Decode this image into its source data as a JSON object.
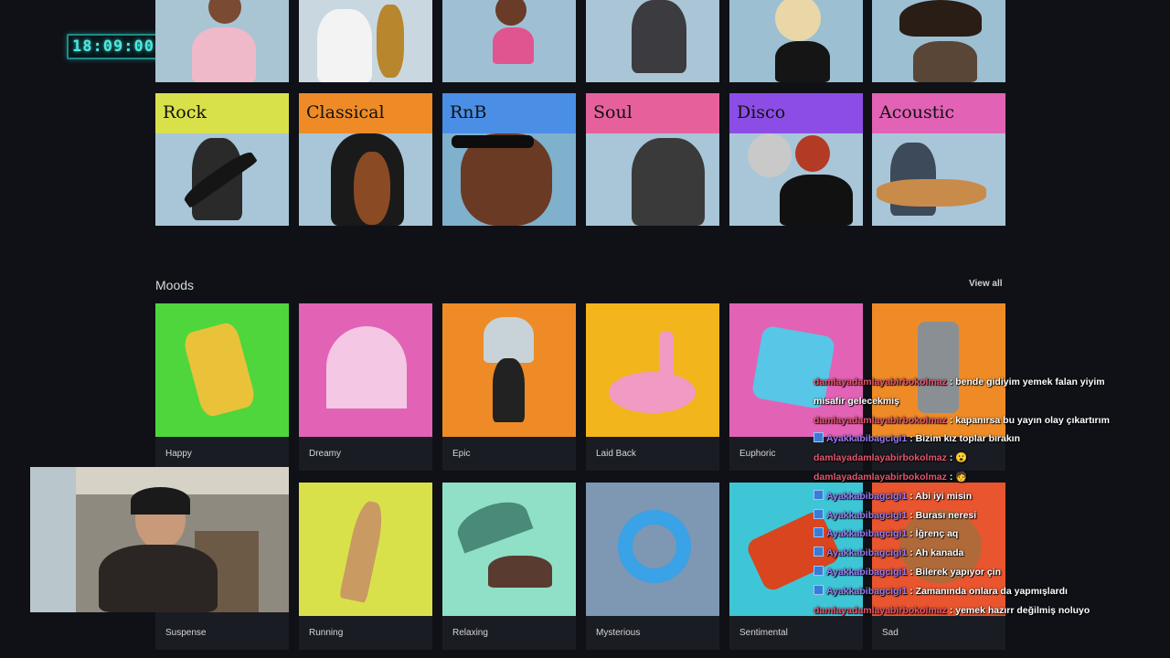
{
  "clock": "18:09:00",
  "genres": [
    {
      "label": "Rock",
      "color": "#d9e14a"
    },
    {
      "label": "Classical",
      "color": "#ee8b26"
    },
    {
      "label": "RnB",
      "color": "#4a8ee6"
    },
    {
      "label": "Soul",
      "color": "#e6619c"
    },
    {
      "label": "Disco",
      "color": "#8c4de6"
    },
    {
      "label": "Acoustic",
      "color": "#e262b6"
    }
  ],
  "moods_section": {
    "title": "Moods",
    "view_all": "View all"
  },
  "moods_row1": [
    {
      "label": "Happy",
      "color": "#4fd63c"
    },
    {
      "label": "Dreamy",
      "color": "#e263b6"
    },
    {
      "label": "Epic",
      "color": "#ee8b26"
    },
    {
      "label": "Laid Back",
      "color": "#f2b51c"
    },
    {
      "label": "Euphoric",
      "color": "#e263b6"
    },
    {
      "label": "",
      "color": "#ee8b26"
    }
  ],
  "moods_row2": [
    {
      "label": "Suspense",
      "color": "#1a1c24"
    },
    {
      "label": "Running",
      "color": "#d9e14a"
    },
    {
      "label": "Relaxing",
      "color": "#8fe0c6"
    },
    {
      "label": "Mysterious",
      "color": "#7e97b3"
    },
    {
      "label": "Sentimental",
      "color": "#3ec6d6"
    },
    {
      "label": "Sad",
      "color": "#e8552e"
    }
  ],
  "chat": [
    {
      "user": "damlayadamlayabirbokolmaz",
      "type": "a",
      "text": ": bende gidiyim yemek falan yiyim misafir gelecekmiş"
    },
    {
      "user": "damlayadamlayabirbokolmaz",
      "type": "a",
      "text": ": kapanırsa bu yayın olay çıkartırım"
    },
    {
      "user": "Ayakkabibagcigi1",
      "type": "b",
      "text": ": Bizim kız toplar bırakın"
    },
    {
      "user": "damlayadamlayabirbokolmaz",
      "type": "a",
      "text": ": 😮"
    },
    {
      "user": "damlayadamlayabirbokolmaz",
      "type": "a",
      "text": ": 🧑"
    },
    {
      "user": "Ayakkabibagcigi1",
      "type": "b",
      "text": ": Abi iyi misin"
    },
    {
      "user": "Ayakkabibagcigi1",
      "type": "b",
      "text": ": Burası neresi"
    },
    {
      "user": "Ayakkabibagcigi1",
      "type": "b",
      "text": ": İğrenç aq"
    },
    {
      "user": "Ayakkabibagcigi1",
      "type": "b",
      "text": ": Ah kanada"
    },
    {
      "user": "Ayakkabibagcigi1",
      "type": "b",
      "text": ": Bilerek yapıyor çin"
    },
    {
      "user": "Ayakkabibagcigi1",
      "type": "b",
      "text": ": Zamanında onlara da yapmışlardı"
    },
    {
      "user": "damlayadamlayabirbokolmaz",
      "type": "a",
      "text": ": yemek hazırr değilmiş noluyo"
    }
  ]
}
